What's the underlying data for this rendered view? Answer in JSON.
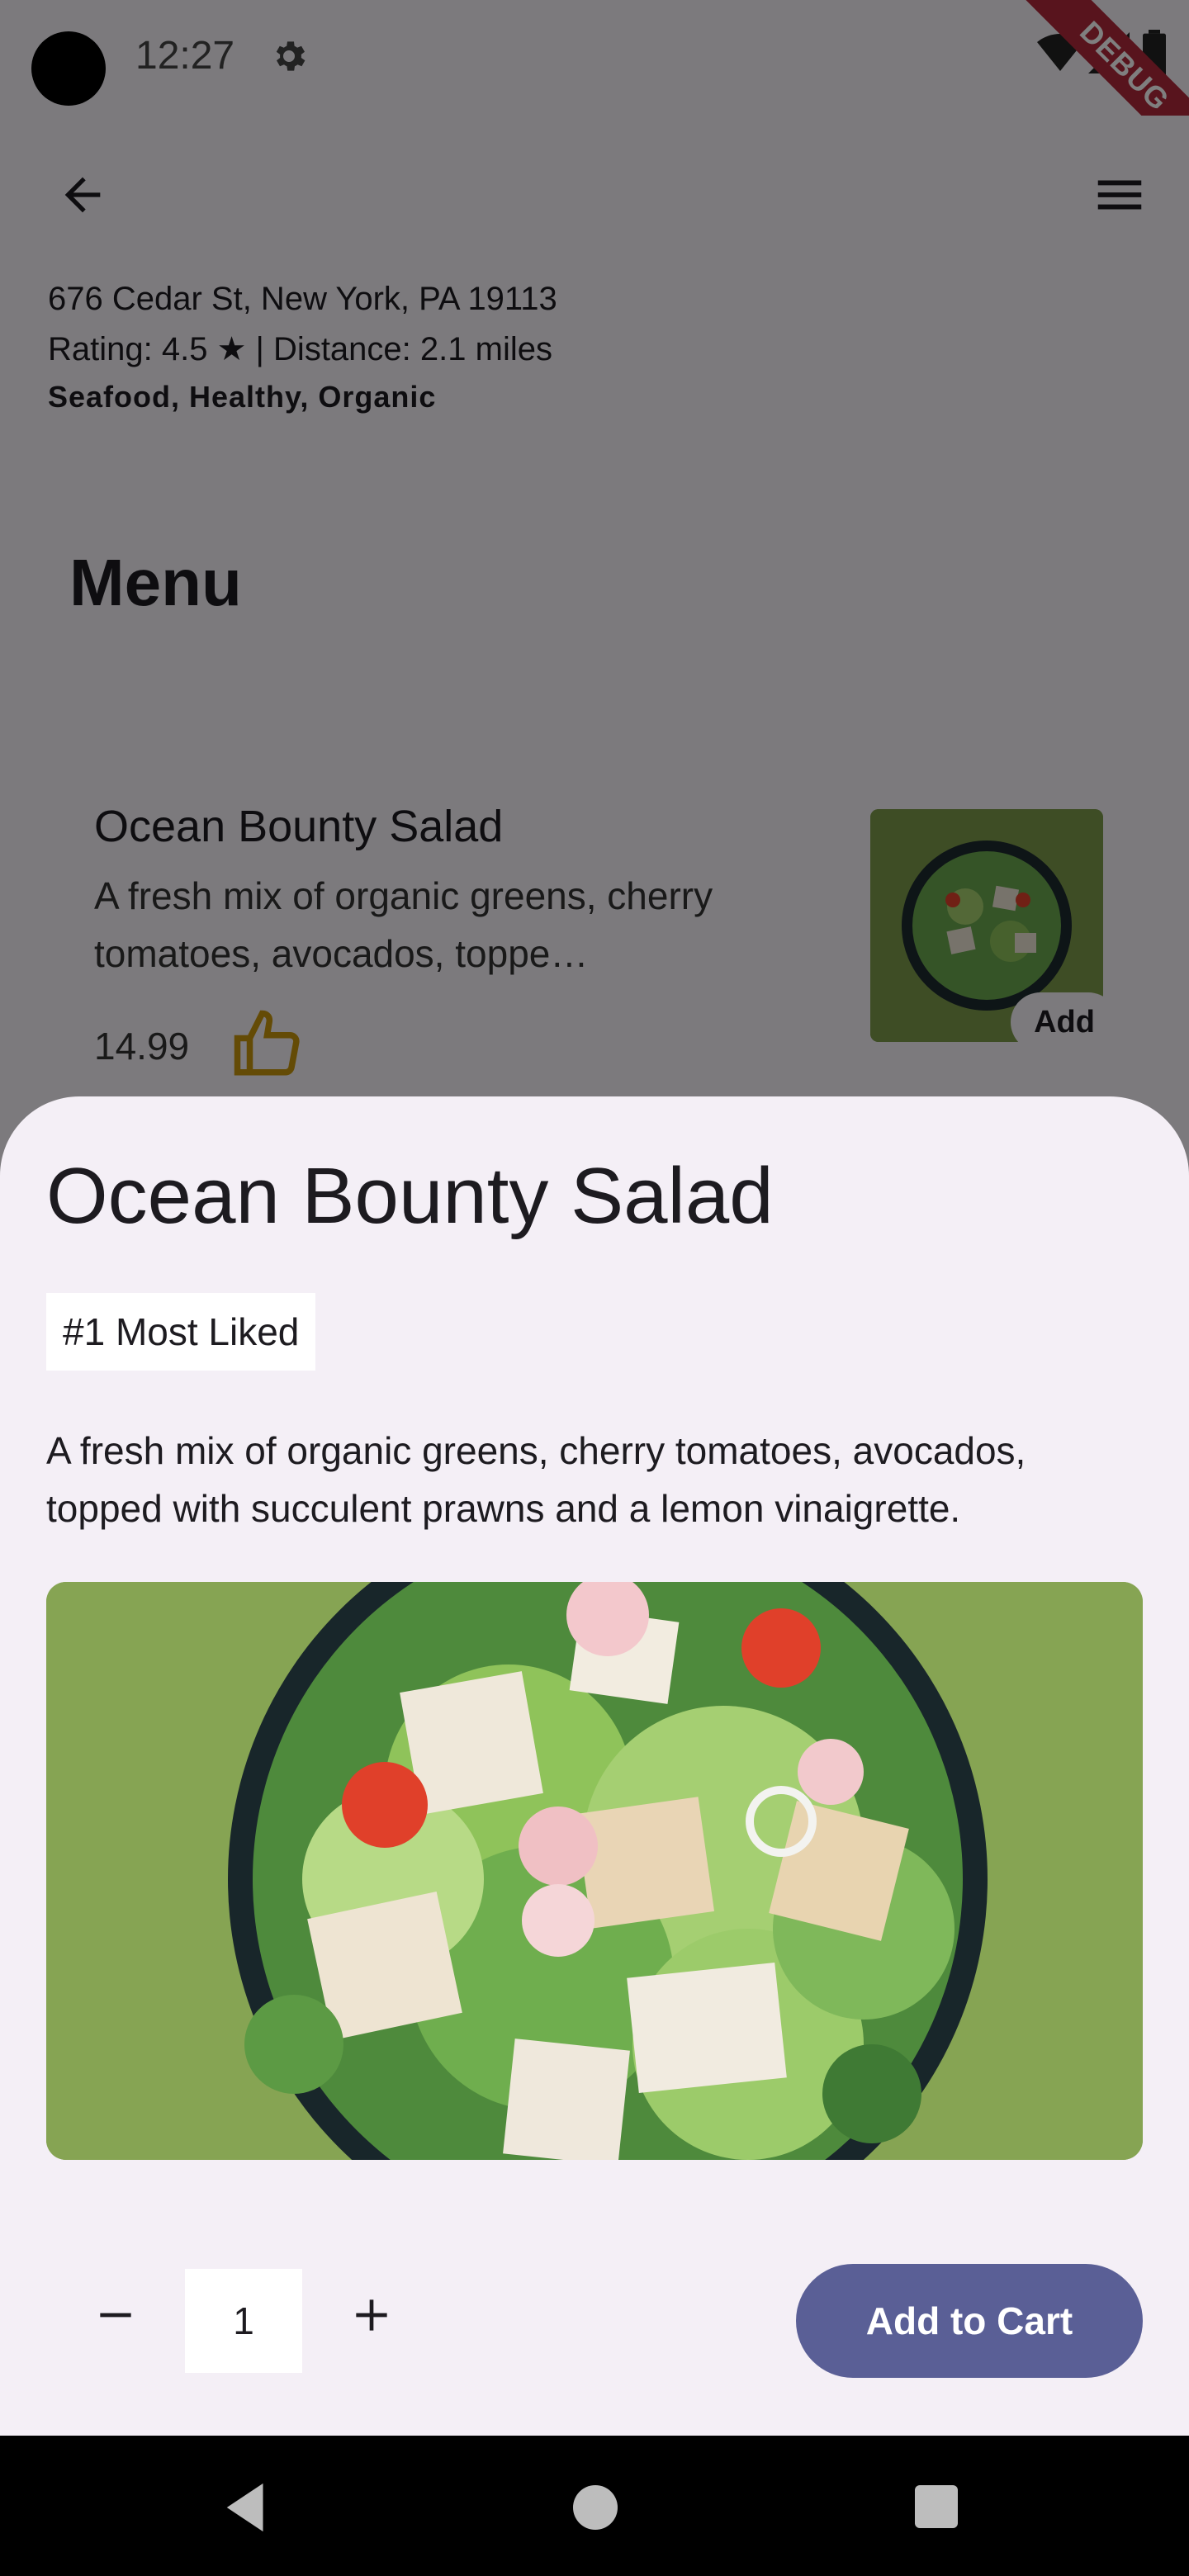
{
  "status_bar": {
    "time": "12:27",
    "debug_label": "DEBUG"
  },
  "app_bar": {
    "back_icon": "arrow-back-icon",
    "menu_icon": "hamburger-menu-icon"
  },
  "restaurant": {
    "address": "676 Cedar St, New York, PA 19113",
    "rating_line": "Rating: 4.5 ★ | Distance: 2.1 miles",
    "cuisine": "Seafood, Healthy, Organic"
  },
  "menu": {
    "heading": "Menu",
    "items": [
      {
        "name": "Ocean Bounty Salad",
        "description": "A fresh mix of organic greens, cherry tomatoes, avocados, toppe…",
        "price": "14.99",
        "add_label": "Add",
        "liked_icon": "thumbs-up-icon"
      }
    ]
  },
  "sheet": {
    "title": "Ocean Bounty Salad",
    "badge": "#1 Most Liked",
    "description": "A fresh mix of organic greens, cherry tomatoes, avocados, topped with succulent prawns and a lemon vinaigrette.",
    "image": "salad-bowl-photo",
    "quantity": "1",
    "add_to_cart_label": "Add to Cart"
  },
  "colors": {
    "primary_button": "#5a5f96",
    "sheet_background": "#f4eff6",
    "debug_banner": "#b1283a",
    "liked_icon": "#c9960c"
  }
}
